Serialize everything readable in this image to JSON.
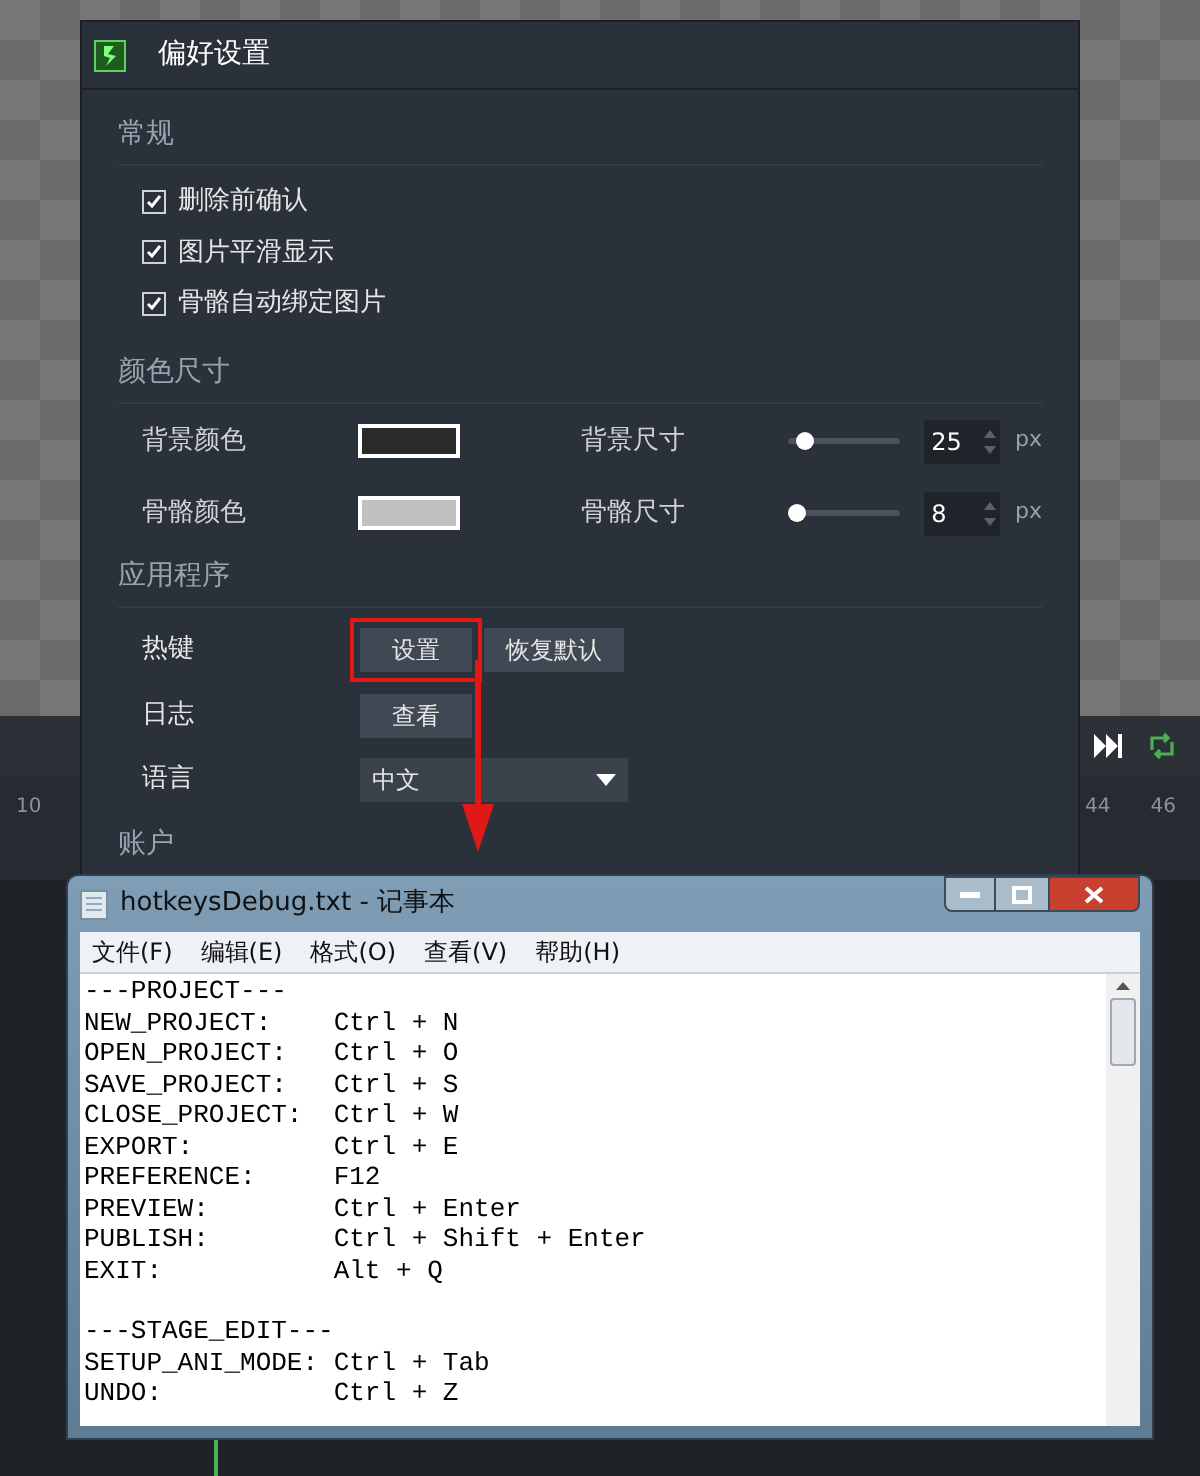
{
  "timeline": {
    "ruler_labels": [
      "10",
      "44",
      "46"
    ]
  },
  "preferences": {
    "title": "偏好设置",
    "general": {
      "heading": "常规",
      "options": [
        {
          "label": "删除前确认",
          "checked": true
        },
        {
          "label": "图片平滑显示",
          "checked": true
        },
        {
          "label": "骨骼自动绑定图片",
          "checked": true
        }
      ]
    },
    "color_size": {
      "heading": "颜色尺寸",
      "colors": [
        {
          "label": "背景颜色",
          "color": "#2a2a2a"
        },
        {
          "label": "骨骼颜色",
          "color": "#c0c0c0"
        }
      ],
      "sizes": [
        {
          "label": "背景尺寸",
          "level": 0.15,
          "value": "25",
          "unit": "px"
        },
        {
          "label": "骨骼尺寸",
          "level": 0.08,
          "value": "8",
          "unit": "px"
        }
      ]
    },
    "application": {
      "heading": "应用程序",
      "hotkeys": {
        "label": "热键",
        "buttons": [
          {
            "label": "设置",
            "highlighted": true
          },
          {
            "label": "恢复默认",
            "highlighted": false
          }
        ]
      },
      "log": {
        "label": "日志",
        "button": "查看"
      },
      "language": {
        "label": "语言",
        "value": "中文"
      }
    },
    "account": {
      "heading": "账户"
    }
  },
  "notepad": {
    "title": "hotkeysDebug.txt - 记事本",
    "menu": [
      "文件(F)",
      "编辑(E)",
      "格式(O)",
      "查看(V)",
      "帮助(H)"
    ],
    "blocks": [
      [
        "---PROJECT---",
        "NEW_PROJECT:    Ctrl + N",
        "OPEN_PROJECT:   Ctrl + O",
        "SAVE_PROJECT:   Ctrl + S",
        "CLOSE_PROJECT:  Ctrl + W",
        "EXPORT:         Ctrl + E",
        "PREFERENCE:     F12",
        "PREVIEW:        Ctrl + Enter",
        "PUBLISH:        Ctrl + Shift + Enter",
        "EXIT:           Alt + Q"
      ],
      [
        "---STAGE_EDIT---",
        "SETUP_ANI_MODE: Ctrl + Tab",
        "UNDO:           Ctrl + Z"
      ]
    ]
  }
}
